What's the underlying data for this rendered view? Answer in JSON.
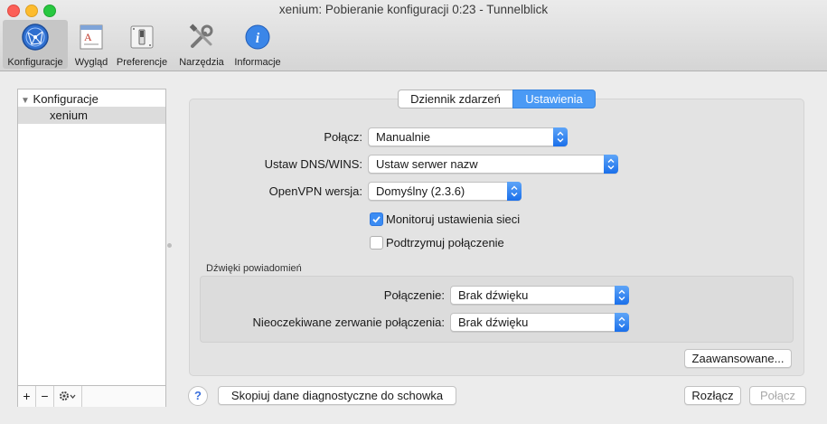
{
  "window": {
    "title": "xenium: Pobieranie konfiguracji 0:23 - Tunnelblick"
  },
  "toolbar": {
    "items": [
      {
        "label": "Konfiguracje"
      },
      {
        "label": "Wygląd"
      },
      {
        "label": "Preferencje"
      },
      {
        "label": "Narzędzia"
      },
      {
        "label": "Informacje"
      }
    ]
  },
  "sidebar": {
    "header": "Konfiguracje",
    "items": [
      "xenium"
    ],
    "footer": {
      "add": "+",
      "remove": "−"
    }
  },
  "tabs": {
    "log": "Dziennik zdarzeń",
    "settings": "Ustawienia"
  },
  "settings": {
    "connect_label": "Połącz:",
    "connect_value": "Manualnie",
    "dns_label": "Ustaw DNS/WINS:",
    "dns_value": "Ustaw serwer nazw",
    "openvpn_label": "OpenVPN wersja:",
    "openvpn_value": "Domyślny (2.3.6)",
    "monitor_label": "Monitoruj ustawienia sieci",
    "monitor_checked": true,
    "keepalive_label": "Podtrzymuj połączenie",
    "keepalive_checked": false
  },
  "sounds": {
    "section_title": "Dźwięki powiadomień",
    "connection_label": "Połączenie:",
    "connection_value": "Brak dźwięku",
    "drop_label": "Nieoczekiwane zerwanie połączenia:",
    "drop_value": "Brak dźwięku"
  },
  "buttons": {
    "advanced": "Zaawansowane...",
    "help": "?",
    "copy_diag": "Skopiuj dane diagnostyczne do schowka",
    "disconnect": "Rozłącz",
    "connect": "Połącz"
  },
  "colors": {
    "accent": "#3b8cf3",
    "selected_tab": "#4a9af5"
  }
}
